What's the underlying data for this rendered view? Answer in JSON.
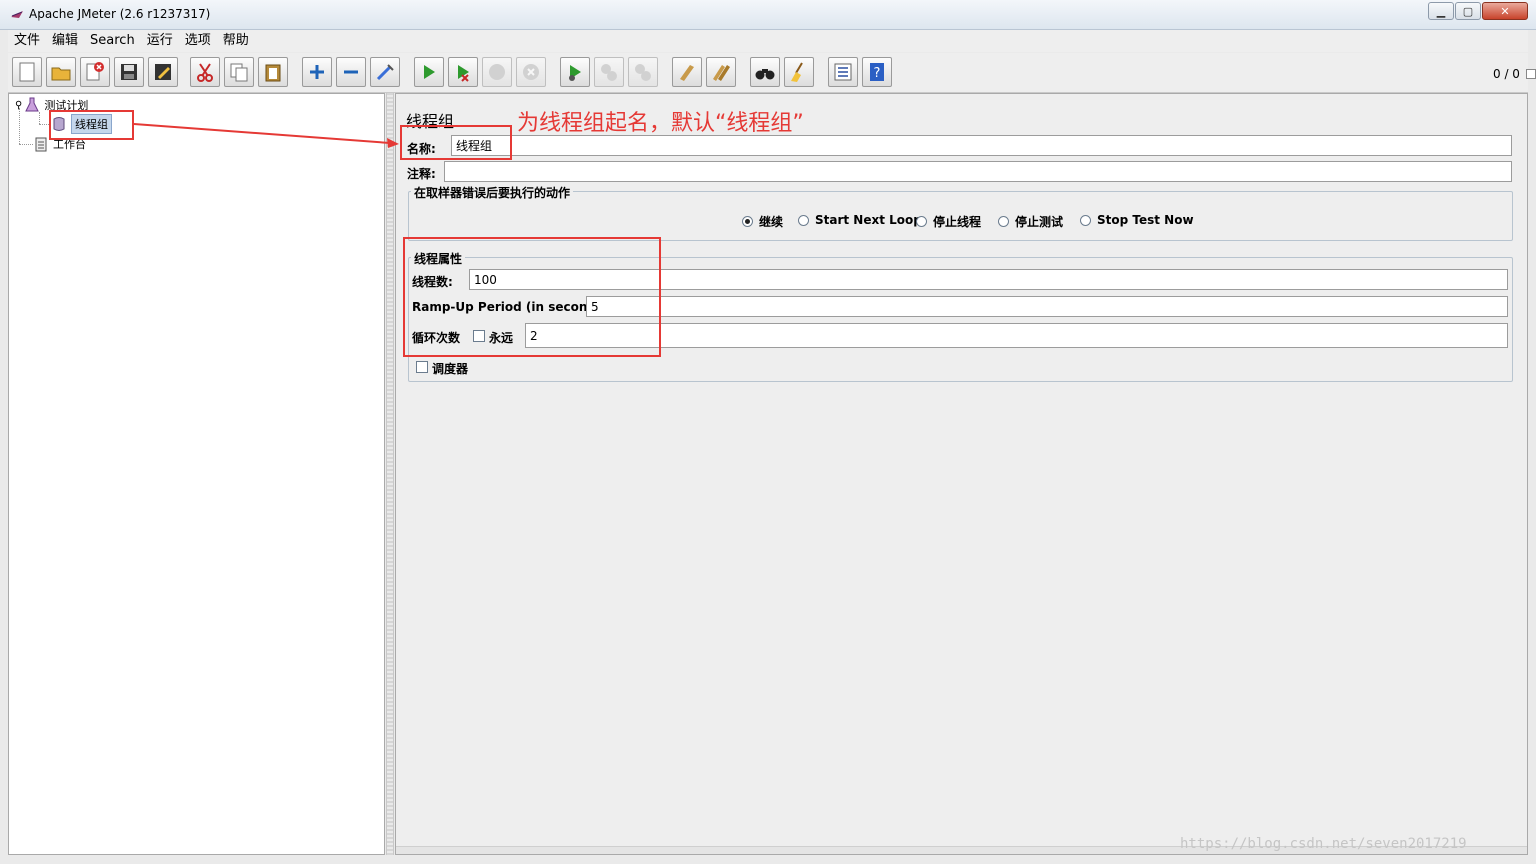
{
  "window": {
    "title": "Apache JMeter (2.6 r1237317)"
  },
  "menu": [
    "文件",
    "编辑",
    "Search",
    "运行",
    "选项",
    "帮助"
  ],
  "toolbar": {
    "counter": "0 / 0",
    "buttons": [
      "new-icon",
      "open-icon",
      "close-icon",
      "save-icon",
      "save-as-icon",
      "cut-icon",
      "copy-icon",
      "paste-icon",
      "expand-icon",
      "collapse-icon",
      "toggle-icon",
      "start-icon",
      "start-no-pause-icon",
      "stop-icon",
      "shutdown-icon",
      "remote-start-icon",
      "remote-stop-icon",
      "remote-shutdown-icon",
      "clear-icon",
      "clear-all-icon",
      "search-icon",
      "reset-search-icon",
      "function-helper-icon",
      "help-icon"
    ]
  },
  "tree": {
    "test_plan": "测试计划",
    "thread_group": "线程组",
    "workbench": "工作台"
  },
  "panel": {
    "title": "线程组",
    "annotation": "为线程组起名，默认“线程组”",
    "name_label": "名称:",
    "name_value": "线程组",
    "comment_label": "注释:",
    "comment_value": "",
    "error_action": {
      "title": "在取样器错误后要执行的动作",
      "options": [
        "继续",
        "Start Next Loop",
        "停止线程",
        "停止测试",
        "Stop Test Now"
      ],
      "selected": "继续"
    },
    "thread_props": {
      "title": "线程属性",
      "threads_label": "线程数:",
      "threads_value": "100",
      "rampup_label": "Ramp-Up Period (in seconds):",
      "rampup_value": "5",
      "loop_label": "循环次数",
      "forever_label": "永远",
      "loop_value": "2"
    },
    "scheduler_label": "调度器"
  },
  "watermark": "https://blog.csdn.net/seven2017219",
  "colors": {
    "annotation": "#e53935",
    "selection": "#c5d7ec"
  }
}
